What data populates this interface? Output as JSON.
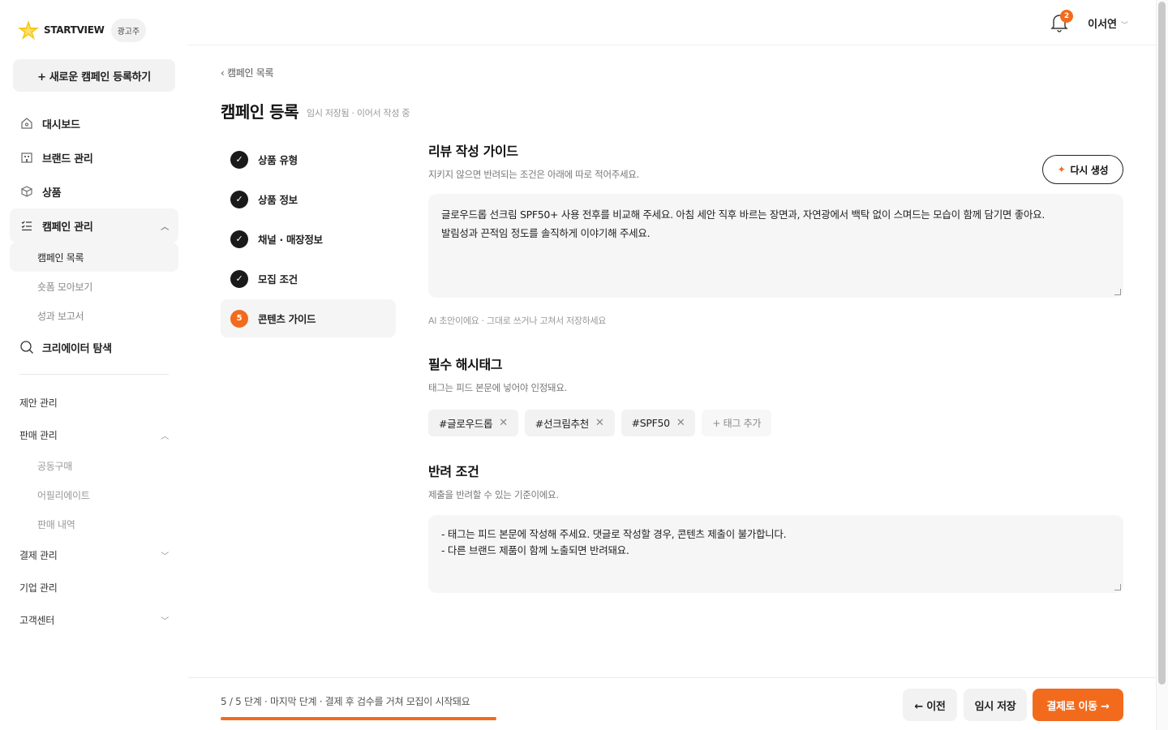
{
  "brand": {
    "logo_text": "STARTVIEW",
    "role_badge": "광고주",
    "accent": "#f26b1d"
  },
  "sidebar": {
    "new_campaign": "+ 새로운 캠페인 등록하기",
    "main_items": [
      {
        "label": "대시보드",
        "icon": "home-icon"
      },
      {
        "label": "브랜드 관리",
        "icon": "building-icon"
      },
      {
        "label": "상품",
        "icon": "box-icon"
      },
      {
        "label": "캠페인 관리",
        "icon": "list-icon"
      }
    ],
    "campaign_sub": [
      "캠페인 목록",
      "숏폼 모아보기",
      "성과 보고서"
    ],
    "creator_search": "크리에이터 탐색",
    "secondary": {
      "proposal": "제안 관리",
      "sales": "판매 관리",
      "sales_sub": [
        "공동구매",
        "어필리에이트",
        "판매 내역"
      ],
      "payment": "결제 관리",
      "company": "기업 관리",
      "support": "고객센터"
    }
  },
  "topbar": {
    "notification_count": "2",
    "user_name": "이서연"
  },
  "main": {
    "breadcrumb": "‹ 캠페인 목록",
    "title": "캠페인 등록",
    "save_status": "임시 저장됨 · 이어서 작성 중",
    "steps": [
      {
        "label": "상품 유형",
        "state": "done"
      },
      {
        "label": "상품 정보",
        "state": "done"
      },
      {
        "label": "채널 · 매장정보",
        "state": "done"
      },
      {
        "label": "모집 조건",
        "state": "done"
      },
      {
        "label": "콘텐츠 가이드",
        "state": "current",
        "num": "5"
      }
    ],
    "review_guide": {
      "title": "리뷰 작성 가이드",
      "desc": "지키지 않으면 반려되는 조건은 아래에 따로 적어주세요.",
      "regen_label": "다시 생성",
      "line1": "글로우드롭 선크림 SPF50+ 사용 전후를 비교해 주세요. 아침 세안 직후 바르는 장면과, 자연광에서 백탁 없이 스며드는 모습이 함께 담기면 좋아요.",
      "line2": "발림성과 끈적임 정도를 솔직하게 이야기해 주세요.",
      "ai_note": "AI 초안이에요 · 그대로 쓰거나 고쳐서 저장하세요"
    },
    "hashtags": {
      "title": "필수 해시태그",
      "desc": "태그는 피드 본문에 넣어야 인정돼요.",
      "tags": [
        "#글로우드롭",
        "#선크림추천",
        "#SPF50"
      ],
      "add_label": "+ 태그 추가"
    },
    "rejection": {
      "title": "반려 조건",
      "desc": "제출을 반려할 수 있는 기준이에요.",
      "line1": "- 태그는 피드 본문에 작성해 주세요. 댓글로 작성할 경우, 콘텐츠 제출이 불가합니다.",
      "line2": "- 다른 브랜드 제품이 함께 노출되면 반려돼요."
    }
  },
  "footer": {
    "progress_text": "5 / 5 단계 · 마지막 단계 · 결제 후 검수를 거쳐 모집이 시작돼요",
    "progress": 1.0,
    "prev_label": "← 이전",
    "save_label": "임시 저장",
    "pay_label": "결제로 이동 →"
  }
}
